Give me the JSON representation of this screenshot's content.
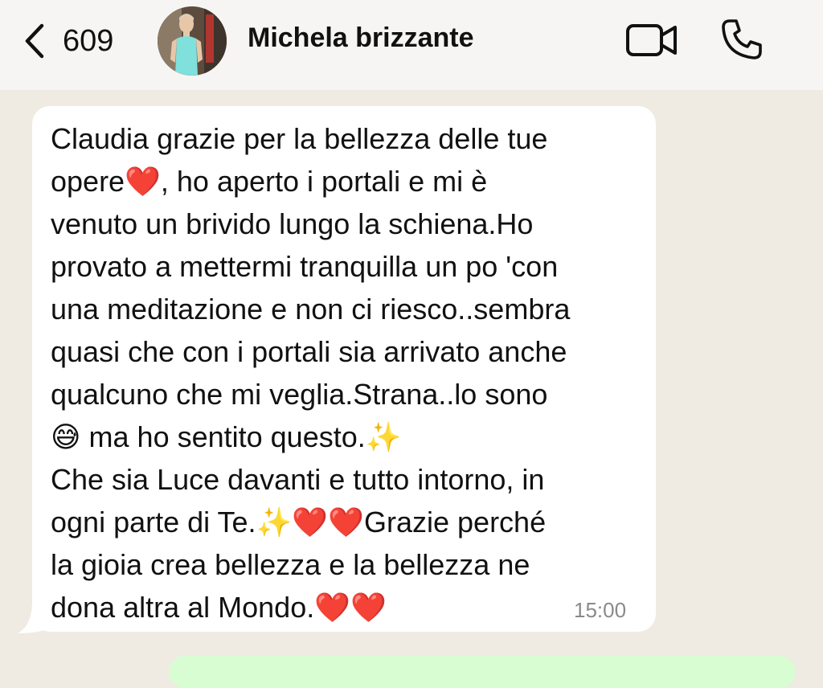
{
  "header": {
    "back_count": "609",
    "contact_name": "Michela brizzante"
  },
  "message": {
    "text": "Claudia grazie per la bellezza delle tue\nopere❤️, ho aperto i portali e mi è\nvenuto un brivido lungo la schiena.Ho\nprovato a mettermi tranquilla un po 'con\nuna meditazione e non ci riesco..sembra\nquasi che con i portali sia arrivato anche\nqualcuno che mi veglia.Strana..lo sono\n😅 ma ho sentito questo.✨\nChe sia Luce davanti e tutto intorno, in\nogni parte di Te.✨❤️❤️Grazie perché\nla gioia crea bellezza e la bellezza ne\ndona altra al Mondo.❤️❤️",
    "time": "15:00"
  },
  "icons": {
    "back": "chevron-left-icon",
    "video": "video-camera-icon",
    "call": "phone-icon"
  },
  "colors": {
    "background": "#efeae2",
    "incoming_bubble": "#ffffff",
    "outgoing_bubble": "#d9fdd3",
    "time_text": "#8a8a8a"
  }
}
